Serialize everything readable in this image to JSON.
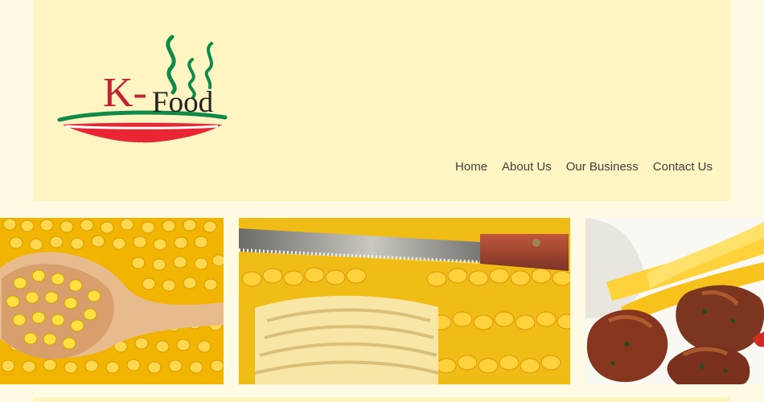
{
  "brand": {
    "logo_k": "K-",
    "logo_food": "Food",
    "colors": {
      "red": "#c32032",
      "green": "#0f8a48",
      "background": "#fffbe3",
      "header": "#fff5c2"
    }
  },
  "nav": {
    "items": [
      {
        "label": "Home"
      },
      {
        "label": "About Us"
      },
      {
        "label": "Our Business"
      },
      {
        "label": "Contact Us"
      }
    ]
  },
  "gallery": {
    "images": [
      {
        "icon": "corn-spoon-image"
      },
      {
        "icon": "corn-butter-knife-image"
      },
      {
        "icon": "meatballs-fries-image"
      }
    ]
  }
}
